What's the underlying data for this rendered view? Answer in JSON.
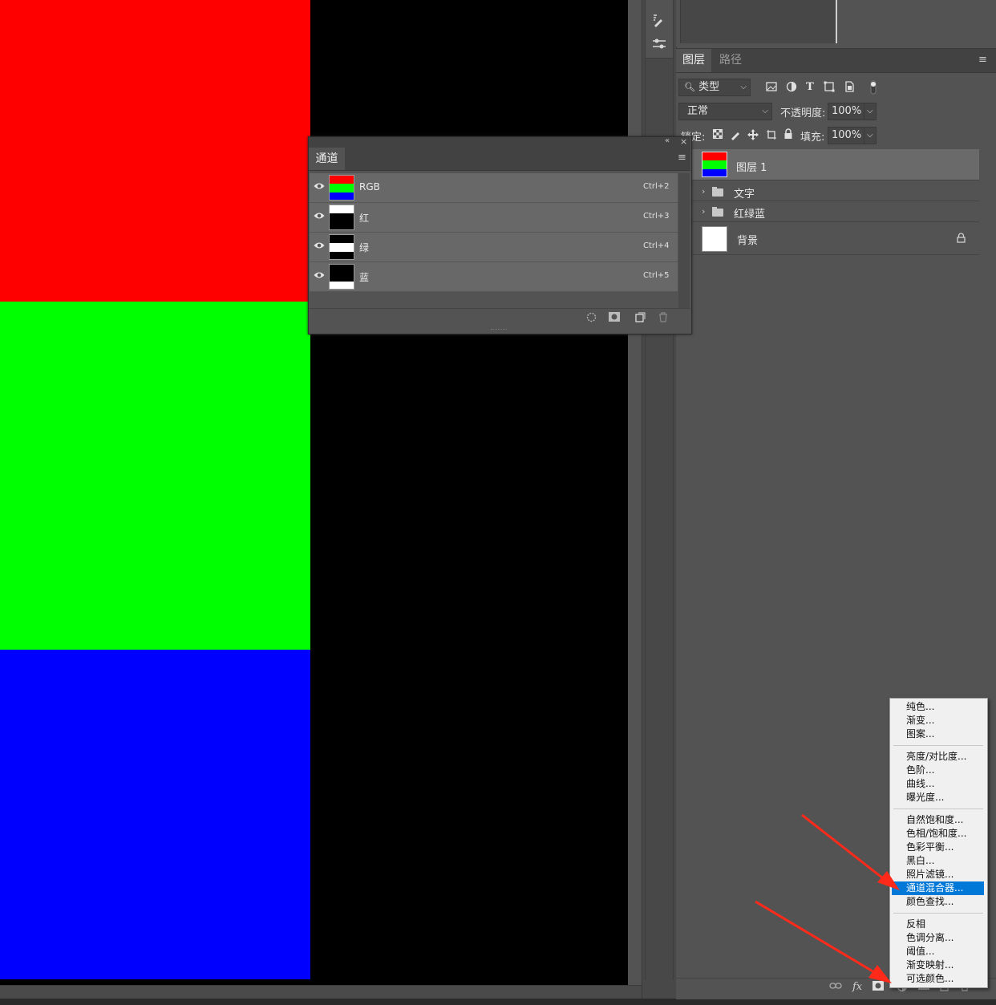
{
  "canvas": {
    "colors": {
      "red": "#ff0000",
      "green": "#00ff00",
      "blue": "#0000ff",
      "background": "#000000"
    }
  },
  "layers_panel": {
    "tabs": [
      {
        "label": "图层"
      },
      {
        "label": "路径"
      }
    ],
    "filter_type": "类型",
    "blend_mode": "正常",
    "opacity_label": "不透明度:",
    "opacity_value": "100%",
    "lock_label": "锁定:",
    "fill_label": "填充:",
    "fill_value": "100%",
    "layers": [
      {
        "name": "图层 1",
        "selected": true,
        "kind": "rgb-layer"
      },
      {
        "name": "文字",
        "kind": "group"
      },
      {
        "name": "红绿蓝",
        "kind": "group"
      },
      {
        "name": "背景",
        "kind": "background",
        "locked": true
      }
    ],
    "footer_icons": [
      "link-icon",
      "fx-icon",
      "mask-icon",
      "adjustment-icon",
      "group-icon",
      "new-layer-icon",
      "delete-icon"
    ],
    "fx_label": "fx"
  },
  "channels_panel": {
    "tab": "通道",
    "channels": [
      {
        "name": "RGB",
        "shortcut": "Ctrl+2"
      },
      {
        "name": "红",
        "shortcut": "Ctrl+3"
      },
      {
        "name": "绿",
        "shortcut": "Ctrl+4"
      },
      {
        "name": "蓝",
        "shortcut": "Ctrl+5"
      }
    ]
  },
  "adjustment_menu": {
    "groups": [
      [
        "纯色...",
        "渐变...",
        "图案..."
      ],
      [
        "亮度/对比度...",
        "色阶...",
        "曲线...",
        "曝光度..."
      ],
      [
        "自然饱和度...",
        "色相/饱和度...",
        "色彩平衡...",
        "黑白...",
        "照片滤镜...",
        "通道混合器...",
        "颜色查找..."
      ],
      [
        "反相",
        "色调分离...",
        "阈值...",
        "渐变映射...",
        "可选颜色..."
      ]
    ],
    "highlighted": "通道混合器...",
    "highlight_color": "#0078d7"
  },
  "annotation": {
    "arrow_color": "#ff2a1a"
  }
}
